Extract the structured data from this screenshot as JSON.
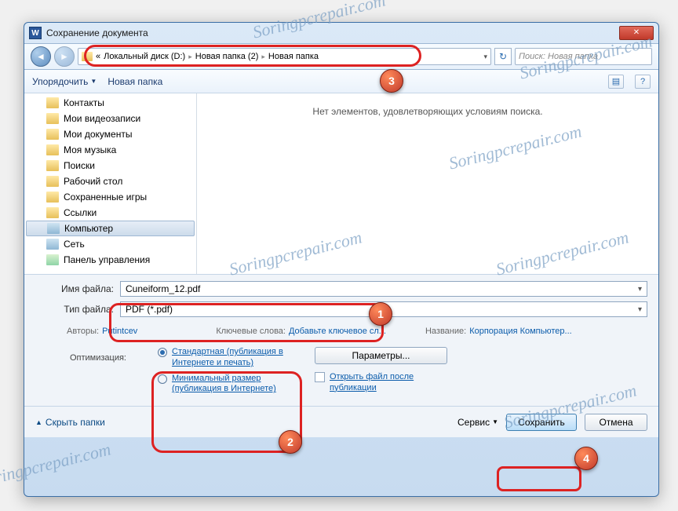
{
  "watermark": "Soringpcrepair.com",
  "window_title": "Сохранение документа",
  "breadcrumb": {
    "prefix": "«",
    "items": [
      "Локальный диск (D:)",
      "Новая папка (2)",
      "Новая папка"
    ]
  },
  "search_placeholder": "Поиск: Новая папка",
  "toolbar": {
    "organize": "Упорядочить",
    "new_folder": "Новая папка"
  },
  "tree": {
    "items": [
      {
        "label": "Контакты",
        "kind": "folder"
      },
      {
        "label": "Мои видеозаписи",
        "kind": "folder"
      },
      {
        "label": "Мои документы",
        "kind": "folder"
      },
      {
        "label": "Моя музыка",
        "kind": "folder"
      },
      {
        "label": "Поиски",
        "kind": "folder"
      },
      {
        "label": "Рабочий стол",
        "kind": "folder"
      },
      {
        "label": "Сохраненные игры",
        "kind": "folder"
      },
      {
        "label": "Ссылки",
        "kind": "folder"
      },
      {
        "label": "Компьютер",
        "kind": "special",
        "selected": true
      },
      {
        "label": "Сеть",
        "kind": "special"
      },
      {
        "label": "Панель управления",
        "kind": "special"
      }
    ]
  },
  "empty_message": "Нет элементов, удовлетворяющих условиям поиска.",
  "form": {
    "filename_label": "Имя файла:",
    "filename_value": "Cuneiform_12.pdf",
    "filetype_label": "Тип файла:",
    "filetype_value": "PDF (*.pdf)"
  },
  "meta": {
    "authors_label": "Авторы:",
    "authors_value": "Putintcev",
    "keywords_label": "Ключевые слова:",
    "keywords_value": "Добавьте ключевое сл...",
    "title_label": "Название:",
    "title_value": "Корпорация Компьютер..."
  },
  "optimization": {
    "label": "Оптимизация:",
    "standard": "Стандартная (публикация в Интернете и печать)",
    "minimal": "Минимальный размер (публикация в Интернете)",
    "params_btn": "Параметры...",
    "open_after": "Открыть файл после публикации"
  },
  "footer": {
    "hide": "Скрыть папки",
    "service": "Сервис",
    "save": "Сохранить",
    "cancel": "Отмена"
  },
  "markers": {
    "1": "1",
    "2": "2",
    "3": "3",
    "4": "4"
  }
}
